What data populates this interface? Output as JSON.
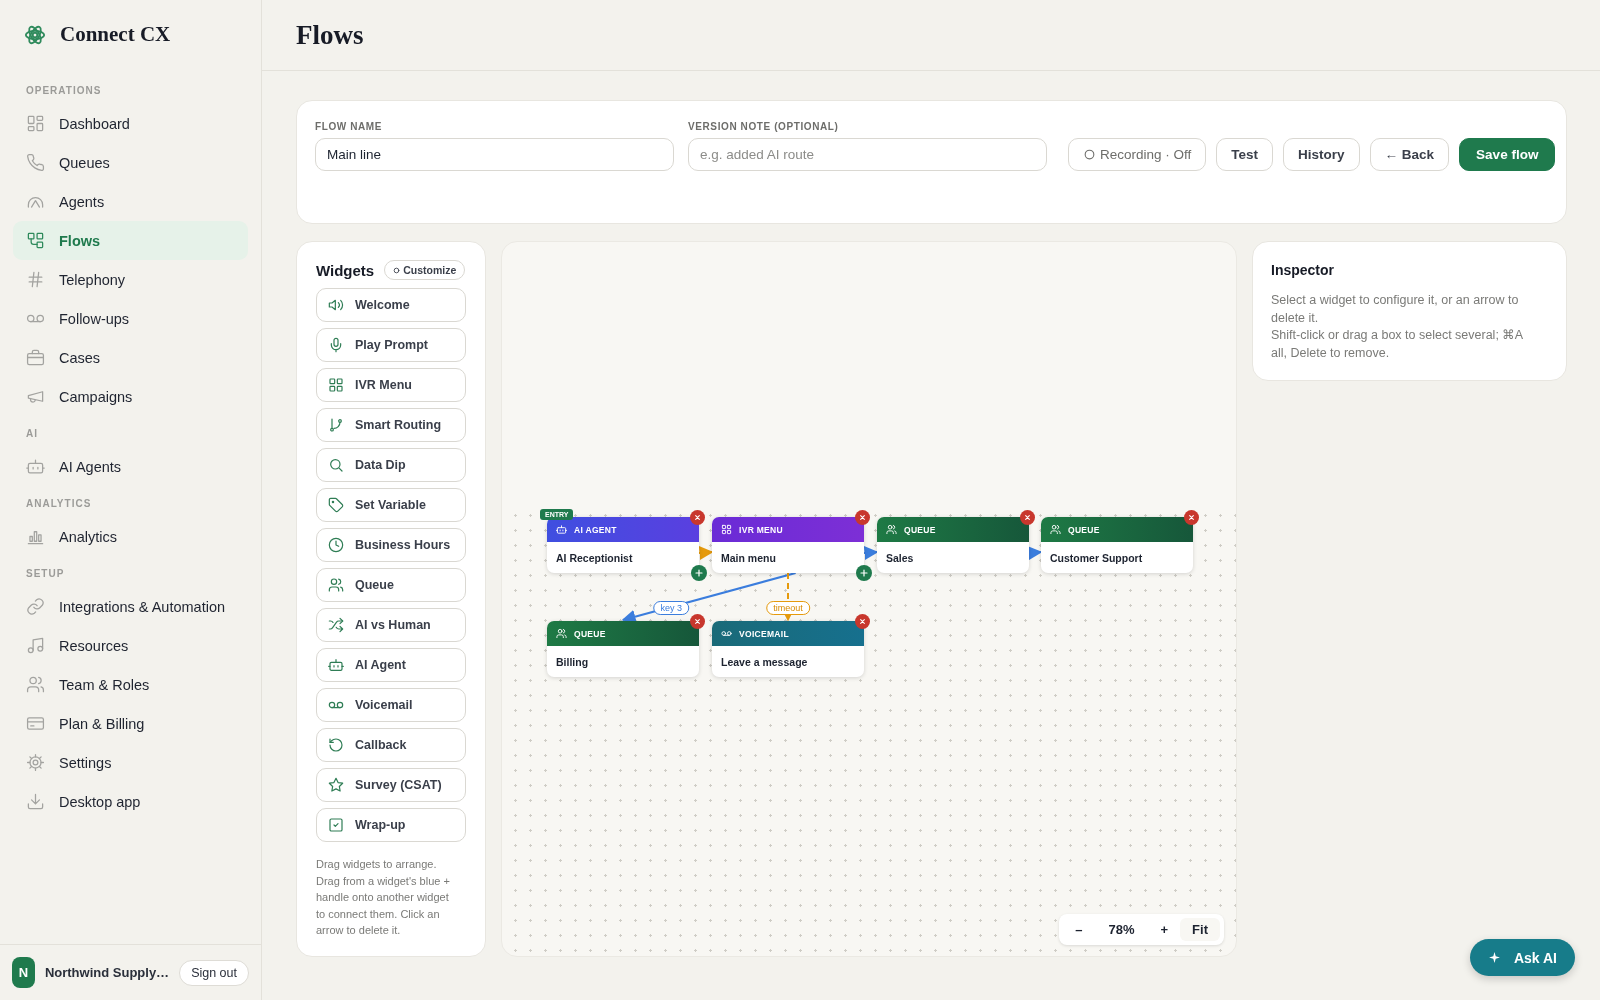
{
  "sidebar": {
    "logo": "Connect CX",
    "sections": [
      {
        "label": "OPERATIONS",
        "items": [
          {
            "label": "Dashboard",
            "selected": false
          },
          {
            "label": "Queues",
            "selected": false
          },
          {
            "label": "Agents",
            "selected": false
          },
          {
            "label": "Flows",
            "selected": true
          },
          {
            "label": "Telephony",
            "selected": false
          },
          {
            "label": "Follow-ups",
            "selected": false
          },
          {
            "label": "Cases",
            "selected": false
          },
          {
            "label": "Campaigns",
            "selected": false
          }
        ]
      },
      {
        "label": "AI",
        "items": [
          {
            "label": "AI Agents",
            "selected": false
          }
        ]
      },
      {
        "label": "ANALYTICS",
        "items": [
          {
            "label": "Analytics",
            "selected": false
          }
        ]
      },
      {
        "label": "SETUP",
        "items": [
          {
            "label": "Integrations & Automation",
            "selected": false
          },
          {
            "label": "Resources",
            "selected": false
          },
          {
            "label": "Team & Roles",
            "selected": false
          },
          {
            "label": "Plan & Billing",
            "selected": false
          },
          {
            "label": "Settings",
            "selected": false
          },
          {
            "label": "Desktop app",
            "selected": false
          }
        ]
      }
    ],
    "account": {
      "initial": "N",
      "name": "Northwind Supply…",
      "sign_out": "Sign out"
    }
  },
  "page": {
    "title": "Flows"
  },
  "flow_form": {
    "fields": [
      {
        "label": "FLOW NAME",
        "value": "Main line"
      },
      {
        "label": "VERSION NOTE (OPTIONAL)",
        "placeholder": "e.g. added AI route"
      }
    ],
    "recording": {
      "label": "Recording · Off",
      "on": false
    },
    "buttons": [
      {
        "label": "Test",
        "kind": "default"
      },
      {
        "label": "History",
        "kind": "default"
      },
      {
        "label": "← Back",
        "kind": "default"
      },
      {
        "label": "Save flow",
        "kind": "primary"
      }
    ]
  },
  "widgets": {
    "title": "Widgets",
    "customize": "Customize",
    "items": [
      "Welcome",
      "Play Prompt",
      "IVR Menu",
      "Smart Routing",
      "Data Dip",
      "Set Variable",
      "Business Hours",
      "Queue",
      "AI vs Human",
      "AI Agent",
      "Voicemail",
      "Callback",
      "Survey (CSAT)",
      "Wrap-up"
    ],
    "help": "Drag widgets to arrange. Drag from a widget's blue + handle onto another widget to connect them. Click an arrow to delete it."
  },
  "canvas": {
    "nodes": [
      {
        "kind": "ai_agent",
        "type_label": "AI AGENT",
        "name": "AI Receptionist",
        "badge": "ENTRY",
        "handle": true
      },
      {
        "kind": "ivr_menu",
        "type_label": "IVR MENU",
        "name": "Main menu",
        "handle": true
      },
      {
        "kind": "queue",
        "type_label": "QUEUE",
        "name": "Sales",
        "handle": false
      },
      {
        "kind": "queue",
        "type_label": "QUEUE",
        "name": "Customer Support",
        "handle": false
      },
      {
        "kind": "queue",
        "type_label": "QUEUE",
        "name": "Billing",
        "handle": false
      },
      {
        "kind": "voicemail",
        "type_label": "VOICEMAIL",
        "name": "Leave a message",
        "handle": false
      }
    ],
    "edges": [
      {
        "kind": "dashed"
      },
      {
        "kind": "solid"
      },
      {
        "kind": "solid",
        "label": "key 3"
      },
      {
        "kind": "dashed",
        "label": "timeout"
      },
      {
        "kind": "solid"
      }
    ],
    "zoom": {
      "out": "–",
      "level": "78%",
      "in": "+",
      "fit": "Fit"
    }
  },
  "inspector": {
    "title": "Inspector",
    "lines": [
      "Select a widget to configure it, or an arrow to delete it.",
      "Shift-click or drag a box to select several; ⌘A all, Delete to remove."
    ]
  },
  "ask_ai": {
    "label": "Ask AI"
  }
}
